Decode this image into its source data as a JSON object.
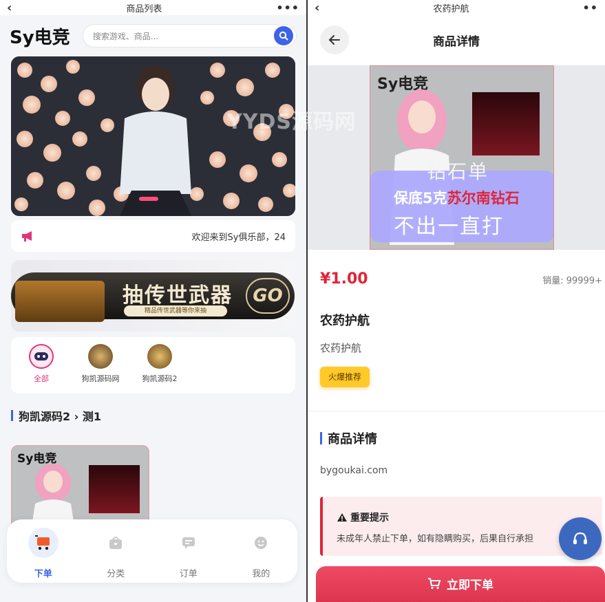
{
  "left": {
    "topbar": {
      "title": "商品列表"
    },
    "brand": "Sy电竞",
    "search": {
      "placeholder": "搜索游戏、商品..."
    },
    "notice": {
      "text": "欢迎来到Sy俱乐部，24"
    },
    "promo": {
      "title": "抽传世武器",
      "subtitle": "精品传世武器等你来抽",
      "go_label": "GO"
    },
    "categories": [
      {
        "label": "全部",
        "active": true
      },
      {
        "label": "狗凯源码网"
      },
      {
        "label": "狗凯源码2"
      }
    ],
    "section": {
      "title": "狗凯源码2 › 测1"
    },
    "product_card": {
      "brand": "Sy电竞"
    },
    "tabbar": [
      {
        "label": "下单",
        "icon": "cart-icon",
        "active": true
      },
      {
        "label": "分类",
        "icon": "bag-icon"
      },
      {
        "label": "订单",
        "icon": "chat-icon"
      },
      {
        "label": "我的",
        "icon": "smile-icon"
      }
    ]
  },
  "right": {
    "topbar": {
      "title": "农药护航"
    },
    "header": {
      "title": "商品详情"
    },
    "hero": {
      "brand": "Sy电竞",
      "line1": "钻石单",
      "line2_prefix": "保底5克",
      "line2_highlight": "苏尔南钻石",
      "line3": "不出一直打"
    },
    "price": "¥1.00",
    "sales": "销量: 99999+",
    "name": "农药护航",
    "desc": "农药护航",
    "tag": "火爆推荐",
    "details": {
      "title": "商品详情",
      "text": "bygoukai.com"
    },
    "warning": {
      "title": "重要提示",
      "text": "未成年人禁止下单，如有隐瞒购买，后果自行承担"
    },
    "buy_label": "立即下单"
  },
  "watermark": "YYDS源码网",
  "colors": {
    "accent": "#3d63e8",
    "price": "#e0243a",
    "tag": "#ffc928",
    "buy": "#e03c57"
  }
}
